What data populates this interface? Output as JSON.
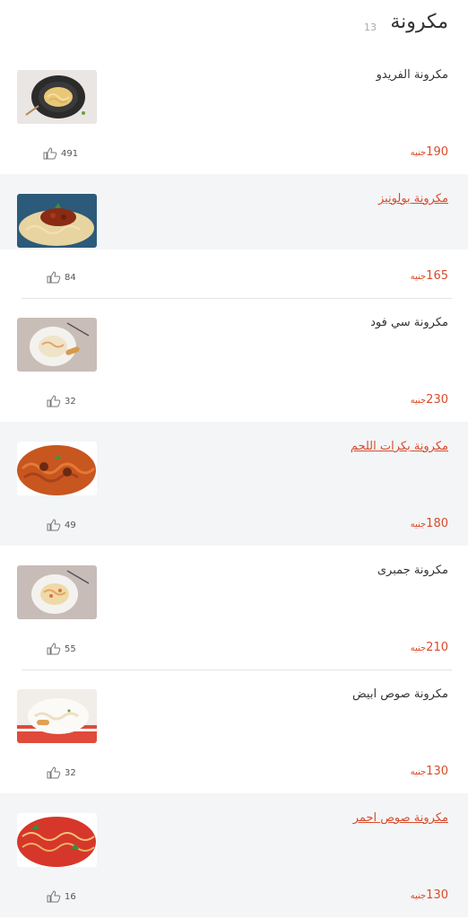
{
  "section": {
    "title": "مكرونة",
    "count": "13"
  },
  "items": [
    {
      "name": "مكرونة الفريدو",
      "price": "190",
      "currency": "جنيه",
      "likes": "491",
      "highlighted": false,
      "image": "pasta-alfredo-dark-bowl"
    },
    {
      "name": "مكرونة بولونيز",
      "price": "165",
      "currency": "جنيه",
      "likes": "84",
      "highlighted": true,
      "image": "pasta-bolognese"
    },
    {
      "name": "مكرونة سي فود",
      "price": "230",
      "currency": "جنيه",
      "likes": "32",
      "highlighted": false,
      "image": "pasta-seafood"
    },
    {
      "name": "مكرونة بكرات اللحم",
      "price": "180",
      "currency": "جنيه",
      "likes": "49",
      "highlighted": true,
      "image": "pasta-meatballs"
    },
    {
      "name": "مكرونة جمبرى",
      "price": "210",
      "currency": "جنيه",
      "likes": "55",
      "highlighted": false,
      "image": "pasta-shrimp"
    },
    {
      "name": "مكرونة صوص ابيض",
      "price": "130",
      "currency": "جنيه",
      "likes": "32",
      "highlighted": false,
      "image": "pasta-white-sauce"
    },
    {
      "name": "مكرونة صوص احمر",
      "price": "130",
      "currency": "جنيه",
      "likes": "16",
      "highlighted": true,
      "image": "pasta-red-sauce"
    }
  ],
  "colors": {
    "accent": "#d94b2b",
    "shaded_bg": "#f4f5f7"
  }
}
